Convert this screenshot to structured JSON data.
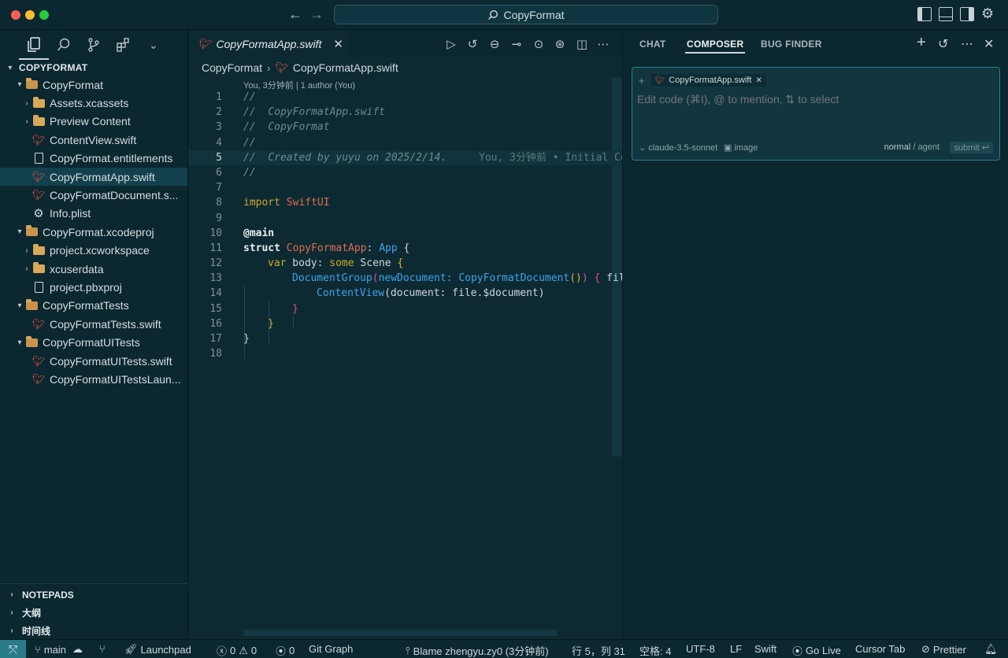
{
  "window": {
    "title": "CopyFormat"
  },
  "sidebar": {
    "section_title": "COPYFORMAT",
    "tree": [
      {
        "label": "CopyFormat",
        "kind": "folder-open",
        "depth": 0
      },
      {
        "label": "Assets.xcassets",
        "kind": "folder",
        "depth": 1
      },
      {
        "label": "Preview Content",
        "kind": "folder",
        "depth": 1
      },
      {
        "label": "ContentView.swift",
        "kind": "swift",
        "depth": 1
      },
      {
        "label": "CopyFormat.entitlements",
        "kind": "doc",
        "depth": 1
      },
      {
        "label": "CopyFormatApp.swift",
        "kind": "swift",
        "depth": 1,
        "selected": true
      },
      {
        "label": "CopyFormatDocument.s...",
        "kind": "swift",
        "depth": 1
      },
      {
        "label": "Info.plist",
        "kind": "gear",
        "depth": 1
      },
      {
        "label": "CopyFormat.xcodeproj",
        "kind": "folder-open",
        "depth": 0
      },
      {
        "label": "project.xcworkspace",
        "kind": "folder",
        "depth": 1
      },
      {
        "label": "xcuserdata",
        "kind": "folder",
        "depth": 1
      },
      {
        "label": "project.pbxproj",
        "kind": "doc",
        "depth": 1
      },
      {
        "label": "CopyFormatTests",
        "kind": "folder-open",
        "depth": 0
      },
      {
        "label": "CopyFormatTests.swift",
        "kind": "swift",
        "depth": 1
      },
      {
        "label": "CopyFormatUITests",
        "kind": "folder-open",
        "depth": 0
      },
      {
        "label": "CopyFormatUITests.swift",
        "kind": "swift",
        "depth": 1
      },
      {
        "label": "CopyFormatUITestsLaun...",
        "kind": "swift",
        "depth": 1
      }
    ],
    "bottom_sections": [
      "NOTEPADS",
      "大纲",
      "时间线"
    ]
  },
  "editor": {
    "tab_label": "CopyFormatApp.swift",
    "breadcrumb": [
      "CopyFormat",
      "CopyFormatApp.swift"
    ],
    "blame_header": "You, 3分钟前 | 1 author (You)",
    "current_line_blame": "You, 3分钟前 • Initial Co",
    "lines": [
      "1",
      "2",
      "3",
      "4",
      "5",
      "6",
      "7",
      "8",
      "9",
      "10",
      "11",
      "12",
      "13",
      "14",
      "15",
      "16",
      "17",
      "18"
    ],
    "code": {
      "l1": "//",
      "l2": "//  CopyFormatApp.swift",
      "l3": "//  CopyFormat",
      "l4": "//",
      "l5": "//  Created by yuyu on 2025/2/14.",
      "l6": "//",
      "l8_kw": "import",
      "l8_mod": " SwiftUI",
      "l10": "@main",
      "l11_kw": "struct",
      "l11_name": " CopyFormatApp",
      "l11_colon": ": ",
      "l11_type": "App",
      "l11_brace": " {",
      "l12_kw": "var",
      "l12_name": " body: ",
      "l12_some": "some",
      "l12_scene": " Scene ",
      "l12_brace": "{",
      "l13_fn": "DocumentGroup",
      "l13_open": "(",
      "l13_arg": "newDocument: ",
      "l13_type": "CopyFormatDocument",
      "l13_call": "()",
      "l13_close": ")",
      "l13_brace": " {",
      "l13_rest": " file",
      "l14_fn": "ContentView",
      "l14_rest": "(document: file.$document)",
      "l15": "}",
      "l16": "}",
      "l17": "}"
    }
  },
  "right_panel": {
    "tabs": [
      "CHAT",
      "COMPOSER",
      "BUG FINDER"
    ],
    "active_tab": "COMPOSER",
    "context_chip": "CopyFormatApp.swift",
    "input_placeholder": "Edit code (⌘I), @ to mention, ⇅ to select",
    "model": "claude-3.5-sonnet",
    "image_label": "image",
    "mode_normal": "normal",
    "mode_sep": "/",
    "mode_agent": "agent",
    "submit": "submit ↩"
  },
  "statusbar": {
    "branch": "main",
    "launchpad": "Launchpad",
    "errors": "0",
    "warnings": "0",
    "ports": "0",
    "git_graph": "Git Graph",
    "blame": "Blame zhengyu.zy0 (3分钟前)",
    "position": "行 5，列 31",
    "spaces": "空格: 4",
    "encoding": "UTF-8",
    "eol": "LF",
    "language": "Swift",
    "go_live": "Go Live",
    "cursor_tab": "Cursor Tab",
    "prettier": "Prettier"
  },
  "colors": {
    "background": "#0d2a33",
    "sidebar": "#0b2730",
    "swift": "#f05138",
    "accent": "#2a7c89",
    "folder": "#d9a85a"
  }
}
